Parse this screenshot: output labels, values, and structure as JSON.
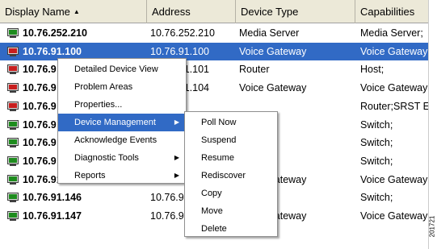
{
  "columns": [
    {
      "label": "Display Name",
      "sort_indicator": "▲"
    },
    {
      "label": "Address"
    },
    {
      "label": "Device Type"
    },
    {
      "label": "Capabilities"
    }
  ],
  "rows": [
    {
      "name": "10.76.252.210",
      "address": "10.76.252.210",
      "type": "Media Server",
      "capabilities": "Media Server;",
      "icon_color": "#1e8c1e",
      "selected": false
    },
    {
      "name": "10.76.91.100",
      "address": "10.76.91.100",
      "type": "Voice Gateway",
      "capabilities": "Voice Gateway",
      "icon_color": "#c81e1e",
      "selected": true
    },
    {
      "name": "10.76.9",
      "address": "10.76.91.101",
      "type": "Router",
      "capabilities": "Host;",
      "icon_color": "#c81e1e",
      "selected": false
    },
    {
      "name": "10.76.9",
      "address": "10.76.91.104",
      "type": "Voice Gateway",
      "capabilities": "Voice Gateway",
      "icon_color": "#c81e1e",
      "selected": false
    },
    {
      "name": "10.76.9",
      "address": "",
      "type": "",
      "capabilities": "Router;SRST E",
      "icon_color": "#c81e1e",
      "selected": false
    },
    {
      "name": "10.76.9",
      "address": "",
      "type": "",
      "capabilities": "Switch;",
      "icon_color": "#1e8c1e",
      "selected": false
    },
    {
      "name": "10.76.9",
      "address": "",
      "type": "",
      "capabilities": "Switch;",
      "icon_color": "#1e8c1e",
      "selected": false
    },
    {
      "name": "10.76.9",
      "address": "",
      "type": "",
      "capabilities": "Switch;",
      "icon_color": "#1e8c1e",
      "selected": false
    },
    {
      "name": "10.76.91.14",
      "address": "10.76.9",
      "type": "Voice Gateway",
      "capabilities": "Voice Gateway",
      "icon_color": "#1e8c1e",
      "selected": false
    },
    {
      "name": "10.76.91.146",
      "address": "10.76.9",
      "type": "",
      "capabilities": "Switch;",
      "icon_color": "#1e8c1e",
      "selected": false
    },
    {
      "name": "10.76.91.147",
      "address": "10.76.91.147",
      "type": "Voice Gateway",
      "capabilities": "Voice Gateway",
      "icon_color": "#1e8c1e",
      "selected": false
    }
  ],
  "context_menu": {
    "items": [
      {
        "label": "Detailed Device View",
        "submenu": false,
        "highlighted": false
      },
      {
        "label": "Problem Areas",
        "submenu": false,
        "highlighted": false
      },
      {
        "label": "Properties...",
        "submenu": false,
        "highlighted": false
      },
      {
        "label": "Device Management",
        "submenu": true,
        "highlighted": true
      },
      {
        "label": "Acknowledge Events",
        "submenu": false,
        "highlighted": false
      },
      {
        "label": "Diagnostic Tools",
        "submenu": true,
        "highlighted": false
      },
      {
        "label": "Reports",
        "submenu": true,
        "highlighted": false
      }
    ],
    "submenu_arrow": "▶"
  },
  "submenu": {
    "items": [
      {
        "label": "Poll Now"
      },
      {
        "label": "Suspend"
      },
      {
        "label": "Resume"
      },
      {
        "label": "Rediscover"
      },
      {
        "label": "Copy"
      },
      {
        "label": "Move"
      },
      {
        "label": "Delete"
      }
    ]
  },
  "figure_id": "201721",
  "colors": {
    "header_bg": "#ece9d8",
    "selection": "#316ac5",
    "device_up": "#1e8c1e",
    "device_down": "#c81e1e"
  }
}
